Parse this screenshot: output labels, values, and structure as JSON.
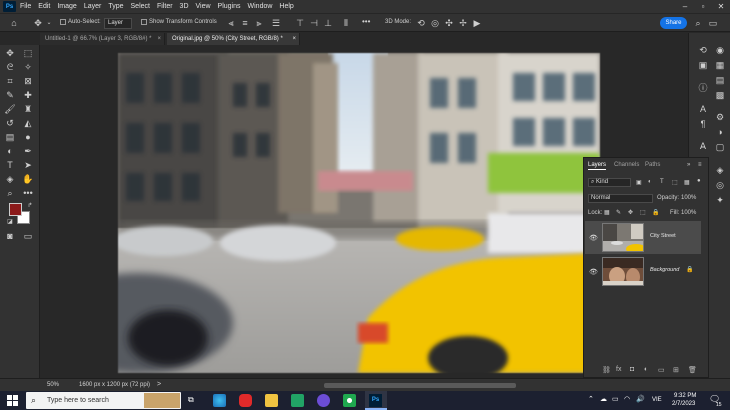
{
  "menubar": {
    "app_icon": "Ps",
    "items": [
      "File",
      "Edit",
      "Image",
      "Layer",
      "Type",
      "Select",
      "Filter",
      "3D",
      "View",
      "Plugins",
      "Window",
      "Help"
    ],
    "window_controls": [
      "minimize-icon",
      "maximize-icon",
      "close-icon"
    ]
  },
  "options": {
    "auto_select_label": "Auto-Select:",
    "auto_select_value": "Layer",
    "show_transform_label": "Show Transform Controls",
    "mode_3d_label": "3D Mode:",
    "more_label": "•••",
    "share_label": "Share"
  },
  "tabs": [
    {
      "label": "Untitled-1 @ 66.7% (Layer 3, RGB/8#) *",
      "active": false
    },
    {
      "label": "Original.jpg @ 50% (City Street, RGB/8) *",
      "active": true
    }
  ],
  "layers_panel": {
    "tabs": [
      "Layers",
      "Channels",
      "Paths"
    ],
    "kind_label": "Kind",
    "blend_mode": "Normal",
    "opacity_label": "Opacity:",
    "opacity_value": "100%",
    "lock_label": "Lock:",
    "fill_label": "Fill:",
    "fill_value": "100%",
    "layers": [
      {
        "name": "City Street",
        "selected": true,
        "locked": false
      },
      {
        "name": "Background",
        "selected": false,
        "locked": true
      }
    ]
  },
  "status": {
    "zoom": "50%",
    "doc_info": "1600 px x 1200 px (72 ppi)",
    "arrow": ">"
  },
  "taskbar": {
    "search_placeholder": "Type here to search",
    "language": "VIE",
    "time": "9:32 PM",
    "date": "2/7/2023",
    "notification_count": "15"
  },
  "colors": {
    "foreground": "#8b1a1a",
    "background": "#ffffff",
    "accent": "#1473e6",
    "taxi_yellow": "#f2c300"
  }
}
